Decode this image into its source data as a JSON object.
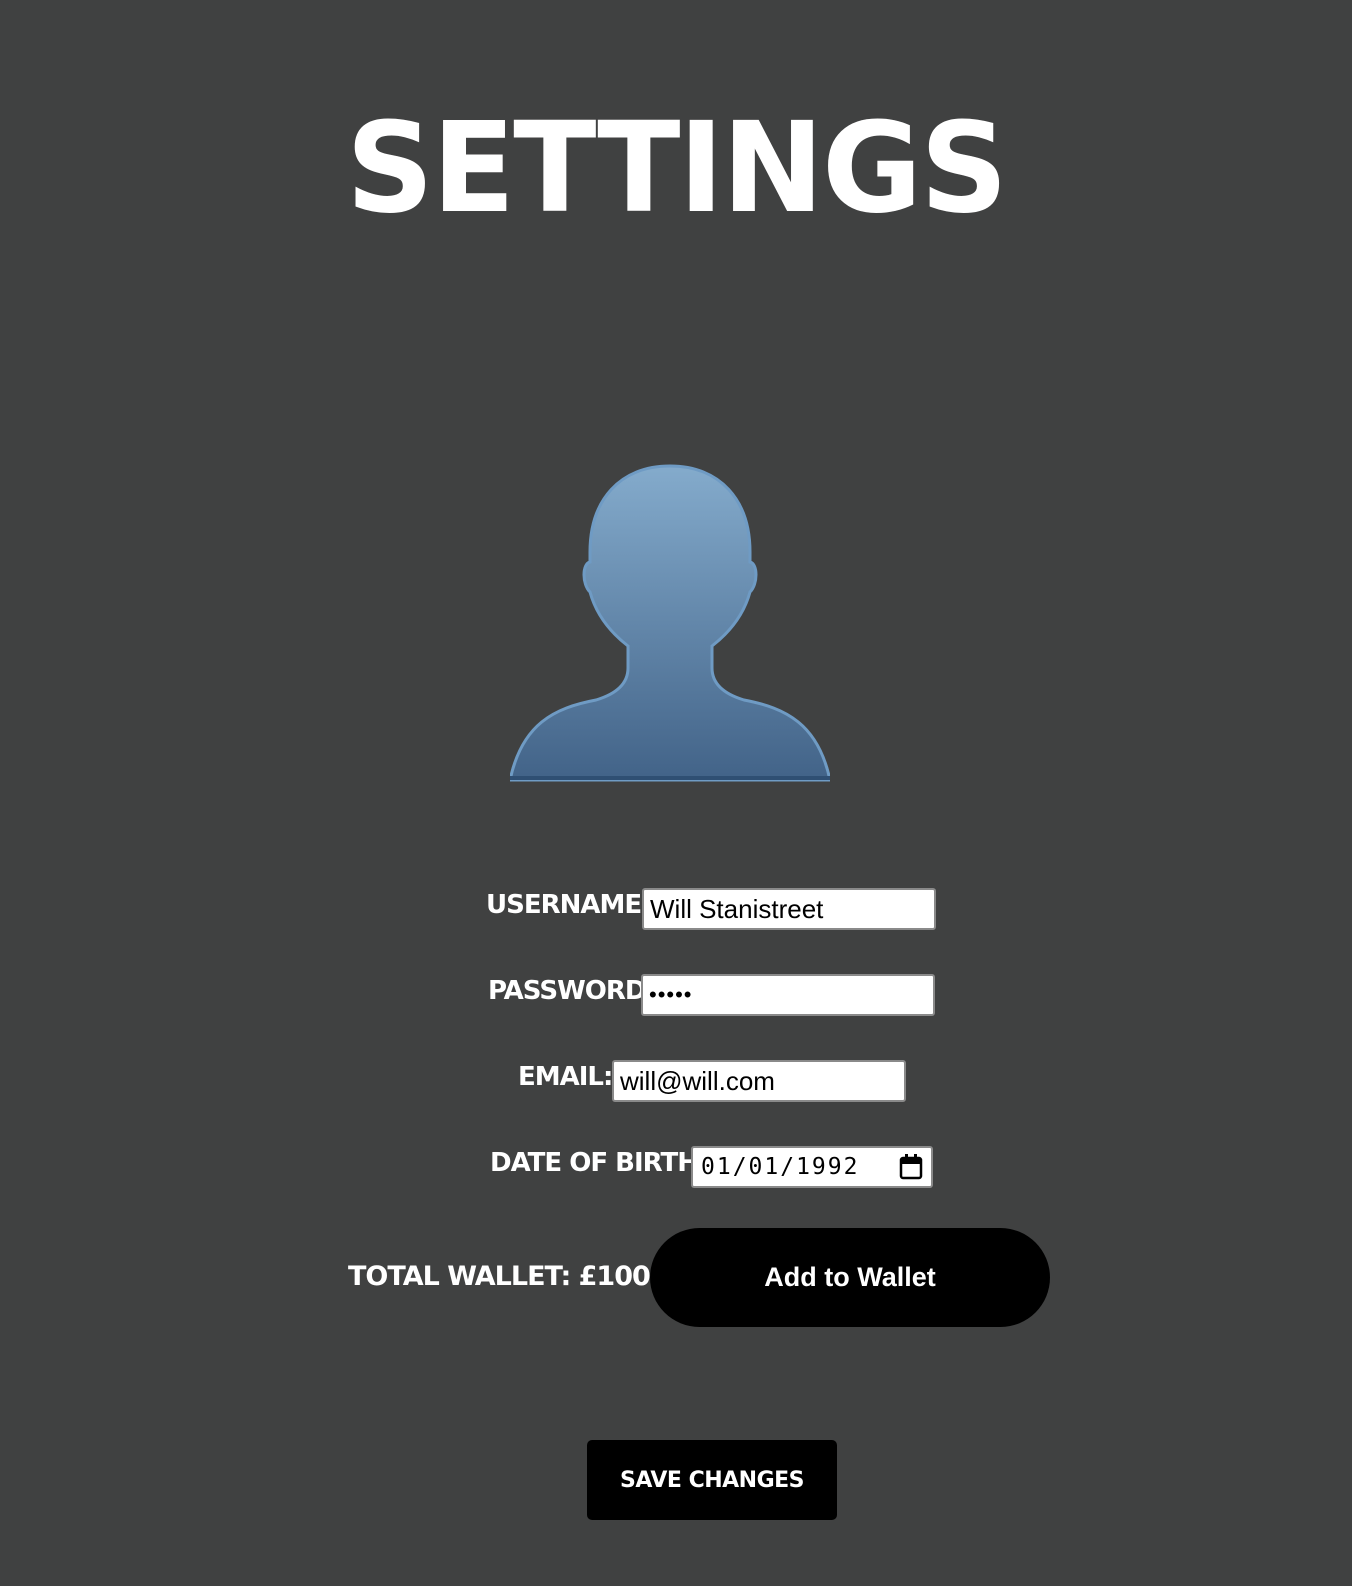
{
  "page": {
    "title": "SETTINGS"
  },
  "avatar": {
    "icon": "user-silhouette-icon",
    "colors": {
      "top": "#84abcc",
      "bottom": "#426388",
      "edge": "#2f4f73"
    }
  },
  "form": {
    "username": {
      "label": "USERNAME:",
      "value": "Will Stanistreet"
    },
    "password": {
      "label": "PASSWORD:",
      "value": "•••••"
    },
    "email": {
      "label": "EMAIL:",
      "value": "will@will.com"
    },
    "date_of_birth": {
      "label": "DATE OF BIRTH:",
      "value": "01/01/1992",
      "icon": "calendar-icon"
    }
  },
  "wallet": {
    "label": "TOTAL WALLET: £100",
    "add_button_label": "Add to Wallet"
  },
  "actions": {
    "save_label": "SAVE CHANGES"
  },
  "colors": {
    "background": "#404141",
    "text": "#ffffff",
    "button": "#000000"
  }
}
